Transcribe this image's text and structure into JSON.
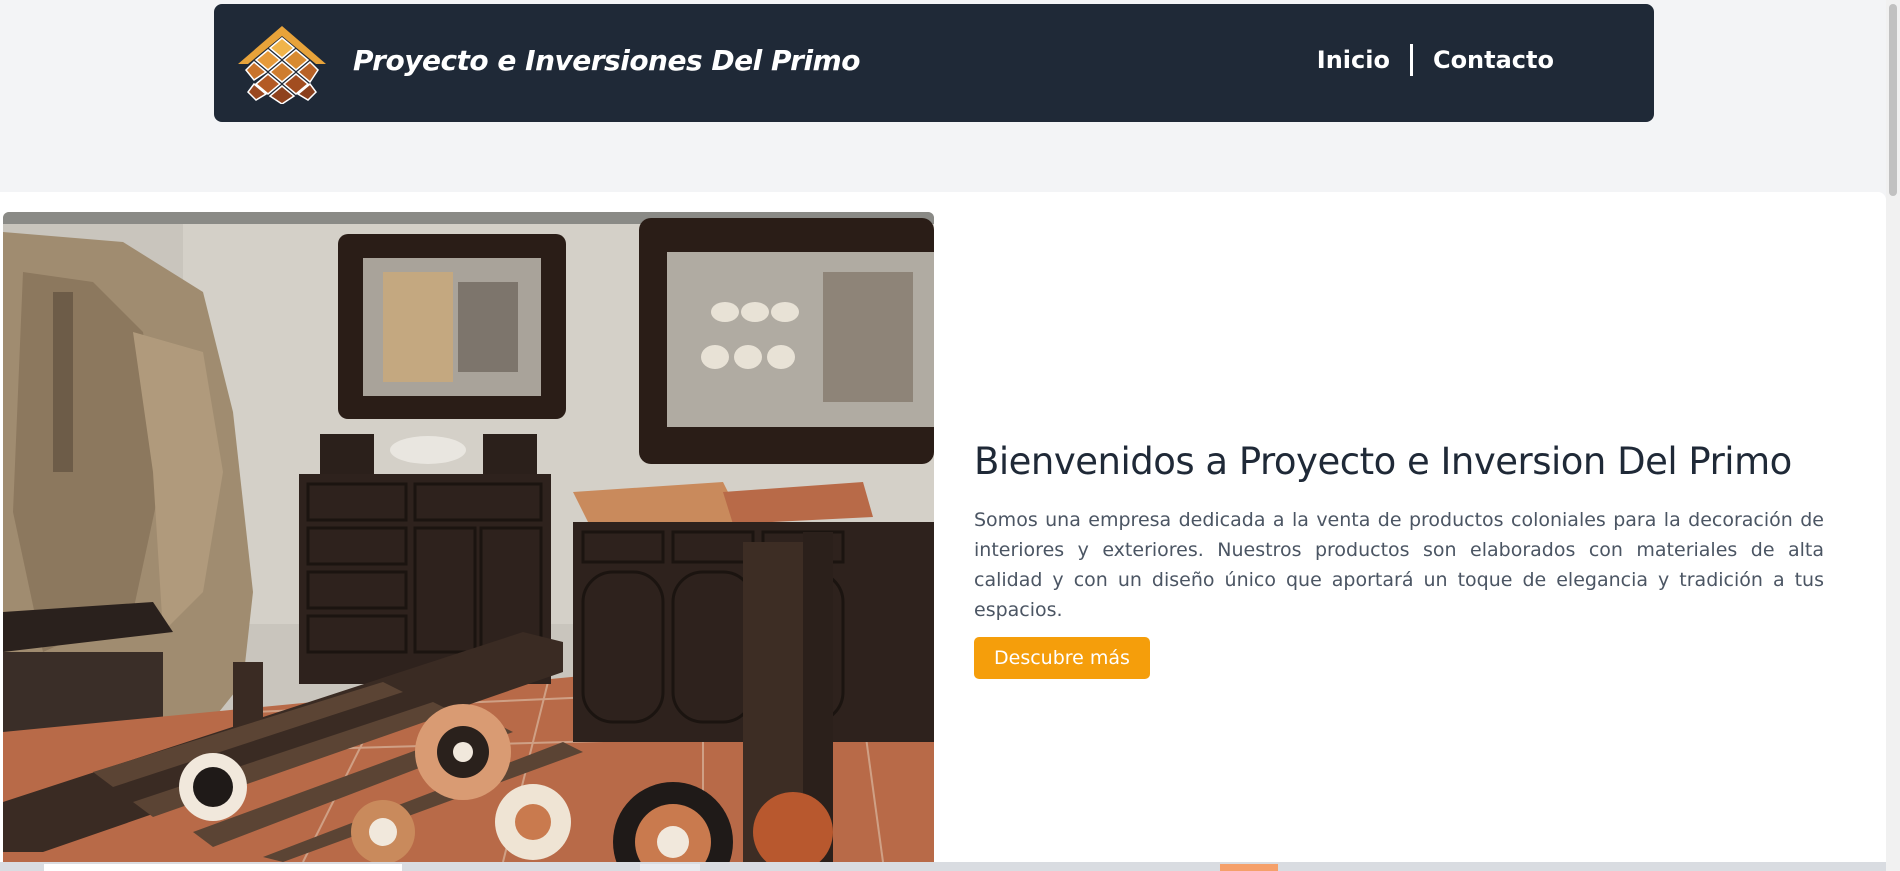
{
  "header": {
    "brand": "Proyecto e Inversiones Del Primo",
    "logo_icon": "tiled-house-logo-icon",
    "nav": [
      {
        "label": "Inicio"
      },
      {
        "label": "Contacto"
      }
    ]
  },
  "hero": {
    "image_icon": "showroom-photo",
    "title": "Bienvenidos a Proyecto e Inversion Del Primo",
    "description": "Somos una empresa dedicada a la venta de productos coloniales para la decoración de interiores y exteriores. Nuestros productos son elaborados con materiales de alta calidad y con un diseño único que aportará un toque de elegancia y tradición a tus espacios.",
    "button_label": "Descubre más"
  },
  "colors": {
    "navbar_bg": "#1f2937",
    "accent": "#f59e0b",
    "page_bg": "#f3f4f6"
  }
}
